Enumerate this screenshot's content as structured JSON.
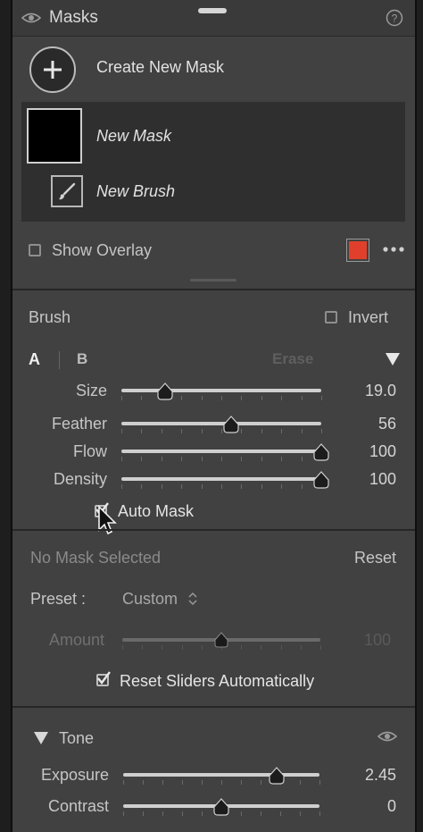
{
  "header": {
    "title": "Masks"
  },
  "create": {
    "label": "Create New Mask"
  },
  "masks_list": [
    {
      "label": "New Mask"
    },
    {
      "label": "New Brush"
    }
  ],
  "overlay": {
    "label": "Show Overlay",
    "color": "#e0402b"
  },
  "brush": {
    "title": "Brush",
    "invert_label": "Invert",
    "tab_a": "A",
    "tab_b": "B",
    "erase_label": "Erase",
    "sliders": [
      {
        "label": "Size",
        "value": "19.0",
        "position": 0.22
      },
      {
        "label": "Feather",
        "value": "56",
        "position": 0.55
      },
      {
        "label": "Flow",
        "value": "100",
        "position": 1.0
      },
      {
        "label": "Density",
        "value": "100",
        "position": 1.0
      }
    ],
    "auto_mask_label": "Auto Mask"
  },
  "selection": {
    "status": "No Mask Selected",
    "reset_label": "Reset",
    "preset_label": "Preset :",
    "preset_value": "Custom",
    "amount_label": "Amount",
    "amount_value": "100",
    "amount_position": 0.5,
    "reset_sliders_label": "Reset Sliders Automatically"
  },
  "tone": {
    "title": "Tone",
    "sliders": [
      {
        "label": "Exposure",
        "value": "2.45",
        "position": 0.78
      },
      {
        "label": "Contrast",
        "value": "0",
        "position": 0.5
      }
    ]
  }
}
